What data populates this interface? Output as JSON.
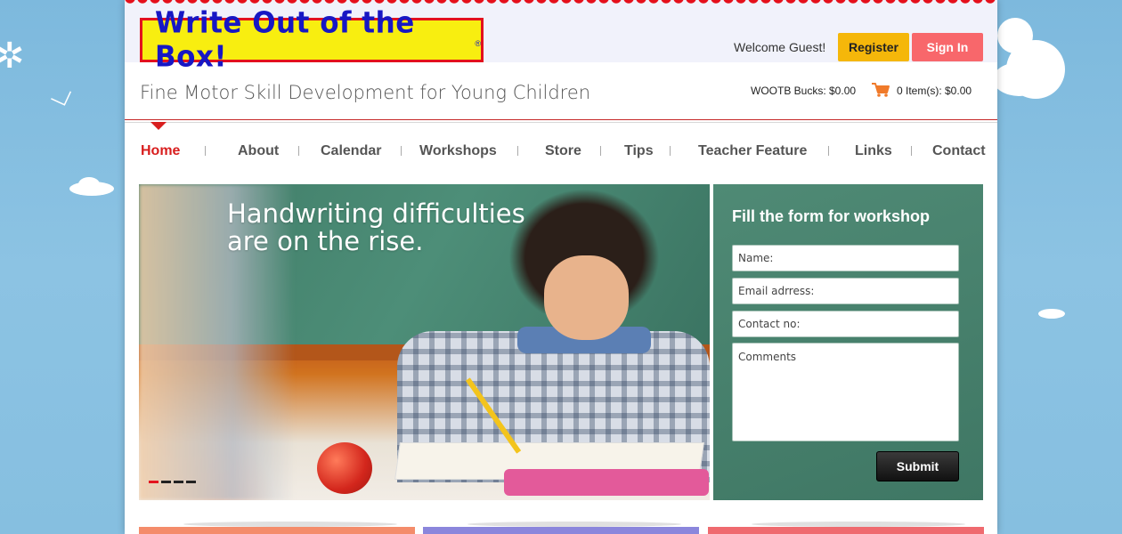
{
  "colors": {
    "accent_red": "#d81e1e",
    "register_yellow": "#f5b70a",
    "signin_pink": "#f8676b",
    "form_green": "#4a8370",
    "logo_yellow": "#f8ee10",
    "logo_blue": "#1717c4",
    "card_colors": [
      "#f48c6b",
      "#8b86dc",
      "#ef6a6f"
    ]
  },
  "header": {
    "logo_text": "Write Out of the Box!",
    "logo_mark": "®",
    "welcome": "Welcome Guest!",
    "register_label": "Register",
    "signin_label": "Sign In",
    "tagline": "Fine Motor Skill Development for Young Children",
    "bucks": "WOOTB Bucks: $0.00",
    "cart_icon": "shopping-cart-icon",
    "items": "0 Item(s): $0.00"
  },
  "nav": {
    "items": [
      {
        "label": "Home",
        "active": true
      },
      {
        "label": "About"
      },
      {
        "label": "Calendar"
      },
      {
        "label": "Workshops"
      },
      {
        "label": "Store"
      },
      {
        "label": "Tips"
      },
      {
        "label": "Teacher Feature"
      },
      {
        "label": "Links"
      },
      {
        "label": "Contact"
      }
    ]
  },
  "hero": {
    "headline_line1": "Handwriting difficulties",
    "headline_line2": "are on the rise.",
    "slide_count": 4,
    "active_slide": 1
  },
  "form": {
    "title": "Fill the form for workshop",
    "name_placeholder": "Name:",
    "email_placeholder": "Email adrress:",
    "contact_placeholder": "Contact no:",
    "comments_placeholder": "Comments",
    "submit_label": "Submit"
  }
}
